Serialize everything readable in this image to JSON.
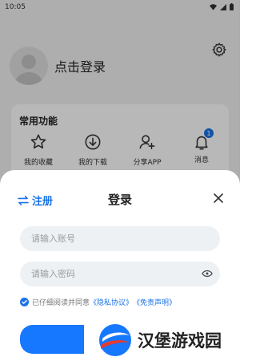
{
  "status_bar": {
    "time": "10:05"
  },
  "profile": {
    "login_prompt": "点击登录"
  },
  "features_card": {
    "title": "常用功能",
    "items": [
      {
        "label": "我的收藏",
        "icon": "star-icon"
      },
      {
        "label": "我的下载",
        "icon": "download-icon"
      },
      {
        "label": "分享APP",
        "icon": "share-user-icon"
      },
      {
        "label": "消息",
        "icon": "bell-icon",
        "badge": "1"
      }
    ]
  },
  "login_sheet": {
    "register_label": "注册",
    "title": "登录",
    "account_placeholder": "请输入账号",
    "password_placeholder": "请输入密码",
    "agree_prefix": "已仔细阅读并同意",
    "privacy_link": "《隐私协议》",
    "disclaimer_link": "《免责声明》"
  },
  "watermark": {
    "text": "汉堡游戏园"
  },
  "colors": {
    "accent": "#1a73e8",
    "button": "#1677ff",
    "input_bg": "#eef1f4"
  }
}
